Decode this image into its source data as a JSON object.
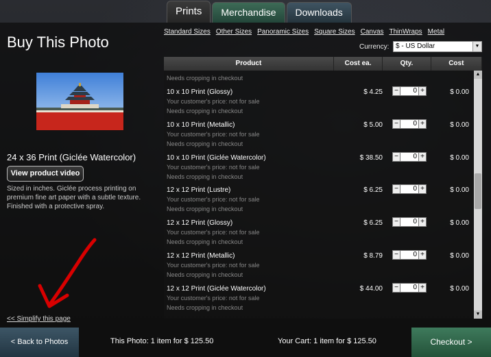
{
  "tabs": [
    "Prints",
    "Merchandise",
    "Downloads"
  ],
  "page_title": "Buy This Photo",
  "size_links": [
    "Standard Sizes",
    "Other Sizes",
    "Panoramic Sizes",
    "Square Sizes",
    "Canvas",
    "ThinWraps",
    "Metal"
  ],
  "currency": {
    "label": "Currency:",
    "value": "$ - US Dollar"
  },
  "product": {
    "name": "24 x 36 Print (Giclée Watercolor)",
    "video_button": "View product video",
    "description": "Sized in inches. Giclée process printing on premium fine art paper with a subtle texture. Finished with a protective spray."
  },
  "simplify_link": "<< Simplify this page",
  "table": {
    "headers": [
      "Product",
      "Cost ea.",
      "Qty.",
      "Cost"
    ],
    "top_partial": "Needs cropping in checkout",
    "rows": [
      {
        "name": "10 x 10 Print (Glossy)",
        "line1": "Your customer's price: not for sale",
        "line2": "Needs cropping in checkout",
        "price": "$ 4.25",
        "qty": "0",
        "total": "$ 0.00"
      },
      {
        "name": "10 x 10 Print (Metallic)",
        "line1": "Your customer's price: not for sale",
        "line2": "Needs cropping in checkout",
        "price": "$ 5.00",
        "qty": "0",
        "total": "$ 0.00"
      },
      {
        "name": "10 x 10 Print (Giclée Watercolor)",
        "line1": "Your customer's price: not for sale",
        "line2": "Needs cropping in checkout",
        "price": "$ 38.50",
        "qty": "0",
        "total": "$ 0.00"
      },
      {
        "name": "12 x 12 Print (Lustre)",
        "line1": "Your customer's price: not for sale",
        "line2": "Needs cropping in checkout",
        "price": "$ 6.25",
        "qty": "0",
        "total": "$ 0.00"
      },
      {
        "name": "12 x 12 Print (Glossy)",
        "line1": "Your customer's price: not for sale",
        "line2": "Needs cropping in checkout",
        "price": "$ 6.25",
        "qty": "0",
        "total": "$ 0.00"
      },
      {
        "name": "12 x 12 Print (Metallic)",
        "line1": "Your customer's price: not for sale",
        "line2": "Needs cropping in checkout",
        "price": "$ 8.79",
        "qty": "0",
        "total": "$ 0.00"
      },
      {
        "name": "12 x 12 Print (Giclée Watercolor)",
        "line1": "Your customer's price: not for sale",
        "line2": "Needs cropping in checkout",
        "price": "$ 44.00",
        "qty": "0",
        "total": "$ 0.00"
      }
    ]
  },
  "footer": {
    "back": "< Back to Photos",
    "this_photo": "This Photo: 1 item for $ 125.50",
    "your_cart": "Your Cart: 1 item for $ 125.50",
    "checkout": "Checkout >"
  },
  "colors": {
    "arrow": "#d80000",
    "checkout": "#2e6a4b",
    "back": "#2f4757"
  }
}
